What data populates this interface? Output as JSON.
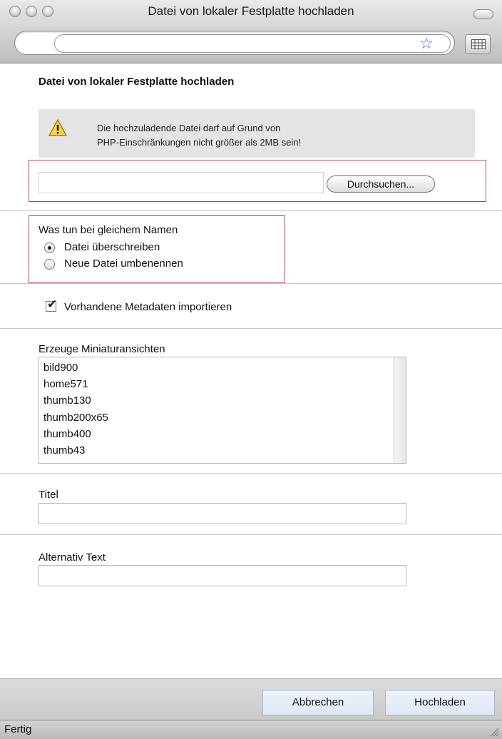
{
  "window": {
    "title": "Datei von lokaler Festplatte hochladen"
  },
  "toolbar": {
    "url_value": "",
    "bookmark_icon": "star-icon",
    "grid_icon": "grid-icon"
  },
  "page": {
    "heading": "Datei von lokaler Festplatte hochladen",
    "warning": {
      "icon": "warning-icon",
      "line1": "Die hochzuladende Datei darf auf Grund von",
      "line2": "PHP-Einschränkungen nicht größer als 2MB sein!"
    },
    "file_input": {
      "value": "",
      "browse_label": "Durchsuchen..."
    },
    "duplicate": {
      "label": "Was tun bei gleichem Namen",
      "options": [
        {
          "label": "Datei überschreiben",
          "selected": true
        },
        {
          "label": "Neue Datei umbenennen",
          "selected": false
        }
      ]
    },
    "metadata": {
      "label": "Vorhandene Metadaten importieren",
      "checked": true
    },
    "thumbnails": {
      "label": "Erzeuge Miniaturansichten",
      "items": [
        "bild900",
        "home571",
        "thumb130",
        "thumb200x65",
        "thumb400",
        "thumb43"
      ]
    },
    "title_field": {
      "label": "Titel",
      "value": ""
    },
    "alt_field": {
      "label": "Alternativ Text",
      "value": ""
    }
  },
  "footer": {
    "cancel_label": "Abbrechen",
    "upload_label": "Hochladen"
  },
  "status": {
    "text": "Fertig"
  },
  "colors": {
    "highlight_border": "#b34a5a",
    "button_bg": "#e6edf7",
    "warning_bg": "#e4e4e4"
  }
}
